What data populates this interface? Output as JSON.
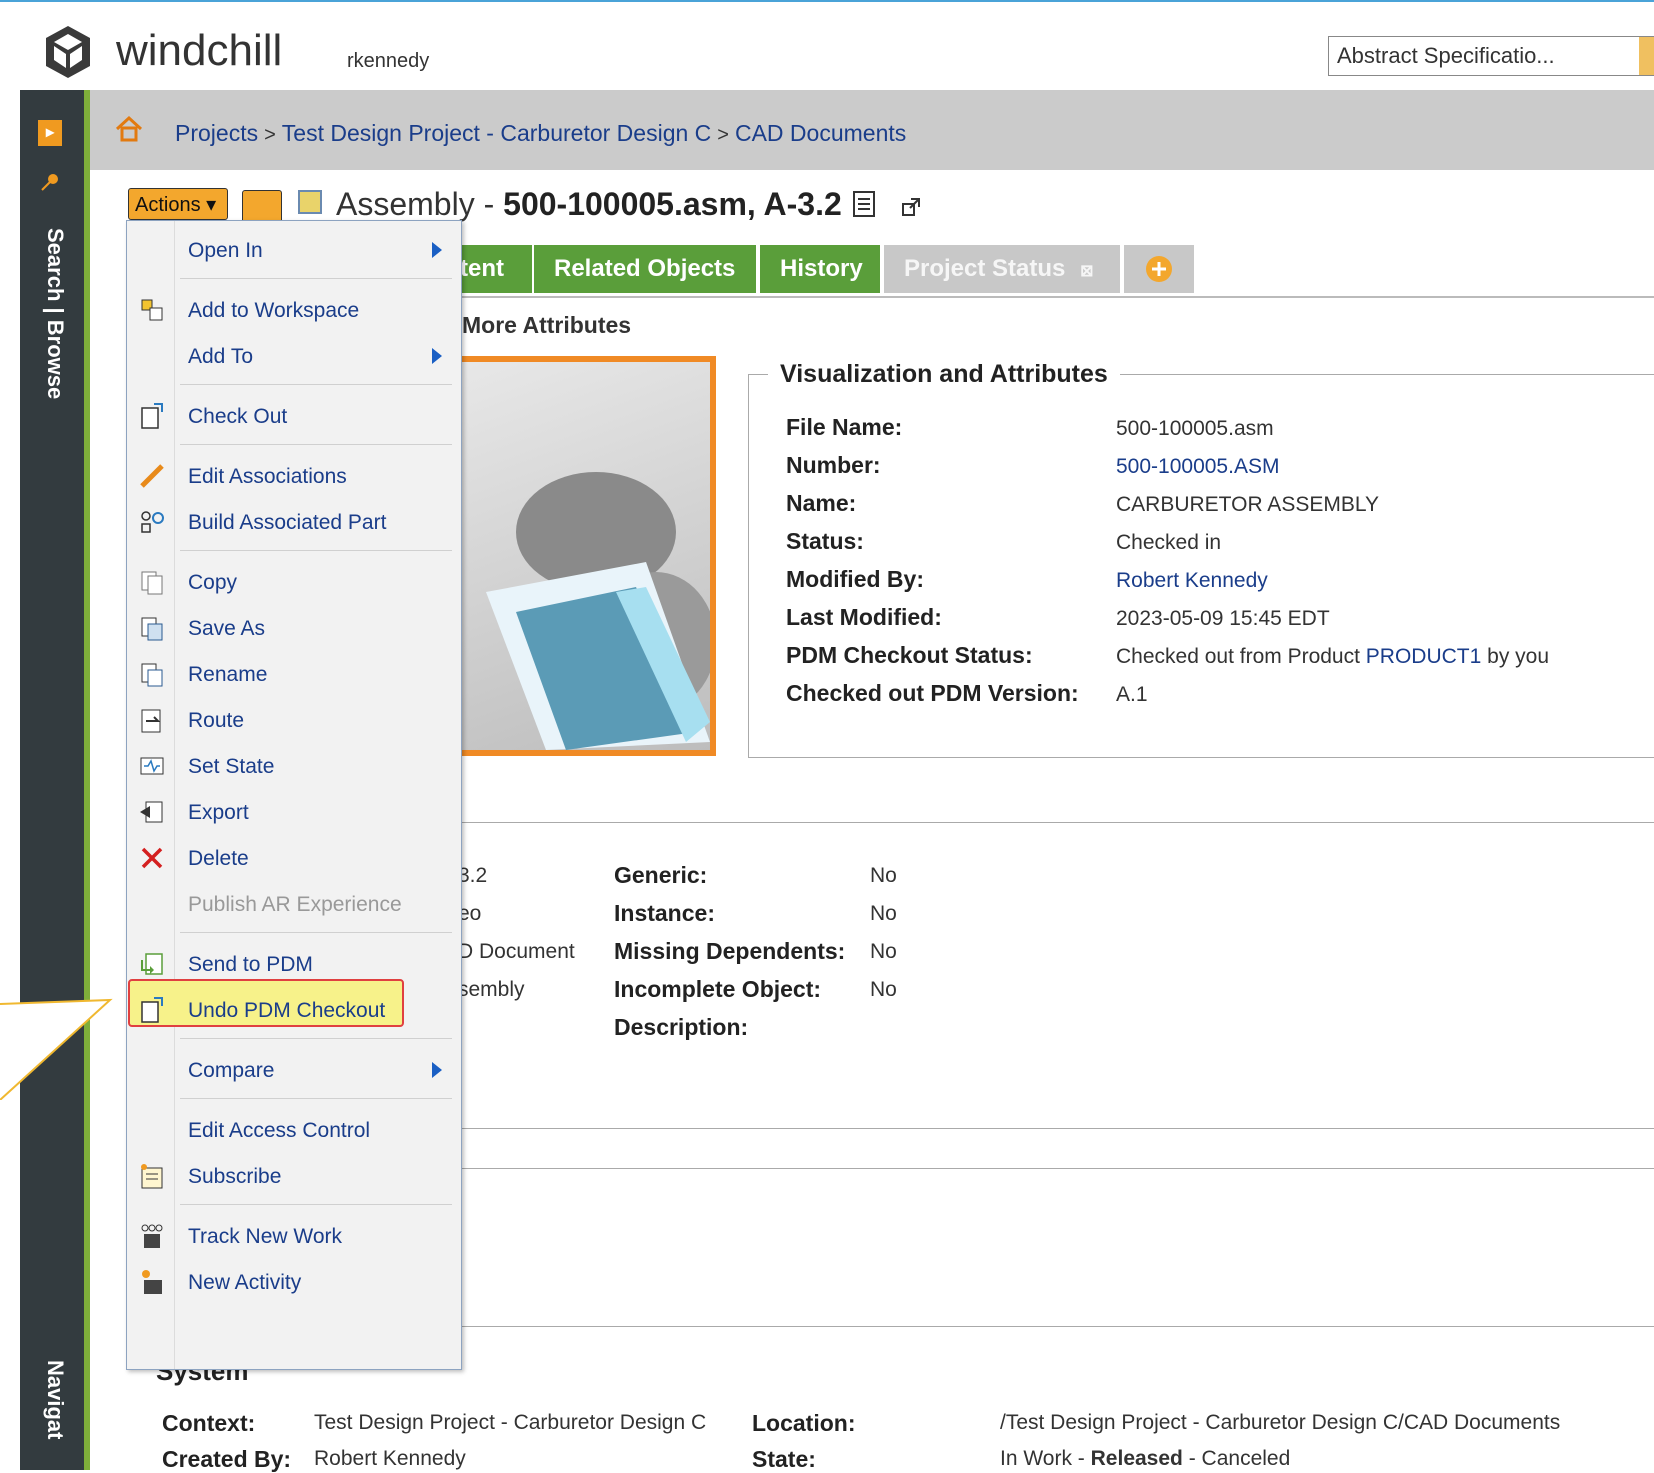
{
  "header": {
    "logo_text": "windchill",
    "user": "rkennedy",
    "context_select": "Abstract Specificatio..."
  },
  "rail": {
    "search_browse": "Search | Browse",
    "navigator": "Navigat"
  },
  "breadcrumb": [
    "Projects",
    "Test Design Project - Carburetor Design C",
    "CAD Documents"
  ],
  "breadcrumb_sep": ">",
  "page": {
    "actions_label": "Actions",
    "title_type": "Assembly",
    "title_sep": " - ",
    "title_id": "500-100005.asm, A-3.2"
  },
  "tabs": [
    {
      "label": "tent",
      "active": true
    },
    {
      "label": "Related Objects",
      "active": true
    },
    {
      "label": "History",
      "active": true
    },
    {
      "label": "Project Status",
      "active": false
    }
  ],
  "more_attributes": "More Attributes",
  "visualization": {
    "title": "Visualization and Attributes",
    "rows": [
      {
        "label": "File Name:",
        "value": "500-100005.asm",
        "link": false
      },
      {
        "label": "Number:",
        "value": "500-100005.ASM",
        "link": true
      },
      {
        "label": "Name:",
        "value": "CARBURETOR ASSEMBLY",
        "link": false
      },
      {
        "label": "Status:",
        "value": "Checked in",
        "link": false
      },
      {
        "label": "Modified By:",
        "value": "Robert Kennedy",
        "link": true
      },
      {
        "label": "Last Modified:",
        "value": "2023-05-09 15:45 EDT",
        "link": false
      },
      {
        "label": "PDM Checkout Status:",
        "value_prefix": "Checked out from Product ",
        "value_link": "PRODUCT1",
        "value_suffix": " by you"
      },
      {
        "label": "Checked out PDM Version:",
        "value": "A.1",
        "link": false
      }
    ]
  },
  "attributes2": {
    "left_values": [
      "3.2",
      "eo",
      "D Document",
      "sembly"
    ],
    "labels": [
      "Generic:",
      "Instance:",
      "Missing Dependents:",
      "Incomplete Object:",
      "Description:"
    ],
    "values": [
      "No",
      "No",
      "No",
      "No"
    ]
  },
  "system": {
    "heading": "System",
    "context_label": "Context:",
    "context_value": "Test Design Project - Carburetor Design C",
    "created_label": "Created By:",
    "created_value": "Robert Kennedy",
    "location_label": "Location:",
    "location_value": "/Test Design Project - Carburetor Design C/CAD Documents",
    "state_label": "State:",
    "state_values": [
      "In Work",
      "Released",
      "Canceled"
    ],
    "state_sep": " - "
  },
  "menu": {
    "items": [
      {
        "label": "Open In",
        "icon": "none",
        "submenu": true
      },
      {
        "label": "Add to Workspace",
        "icon": "add-to-workspace-icon"
      },
      {
        "label": "Add To",
        "icon": "none",
        "submenu": true
      },
      {
        "label": "Check Out",
        "icon": "check-out-icon"
      },
      {
        "label": "Edit Associations",
        "icon": "pencil-icon"
      },
      {
        "label": "Build Associated Part",
        "icon": "build-part-icon"
      },
      {
        "label": "Copy",
        "icon": "copy-icon"
      },
      {
        "label": "Save As",
        "icon": "save-as-icon"
      },
      {
        "label": "Rename",
        "icon": "rename-icon"
      },
      {
        "label": "Route",
        "icon": "route-icon"
      },
      {
        "label": "Set State",
        "icon": "set-state-icon"
      },
      {
        "label": "Export",
        "icon": "export-icon"
      },
      {
        "label": "Delete",
        "icon": "delete-icon"
      },
      {
        "label": "Publish AR Experience",
        "icon": "none",
        "disabled": true
      },
      {
        "label": "Send to PDM",
        "icon": "send-to-pdm-icon"
      },
      {
        "label": "Undo PDM Checkout",
        "icon": "undo-checkout-icon"
      },
      {
        "label": "Compare",
        "icon": "none",
        "submenu": true
      },
      {
        "label": "Edit Access Control",
        "icon": "none"
      },
      {
        "label": "Subscribe",
        "icon": "subscribe-icon"
      },
      {
        "label": "Track New Work",
        "icon": "track-work-icon"
      },
      {
        "label": "New Activity",
        "icon": "new-activity-icon"
      }
    ]
  },
  "colors": {
    "tab_green": "#5a9e3a",
    "action_orange": "#f3a72d",
    "link_blue": "#1a3d8a",
    "highlight_yellow": "#f7f28a",
    "highlight_border": "#e04040"
  }
}
